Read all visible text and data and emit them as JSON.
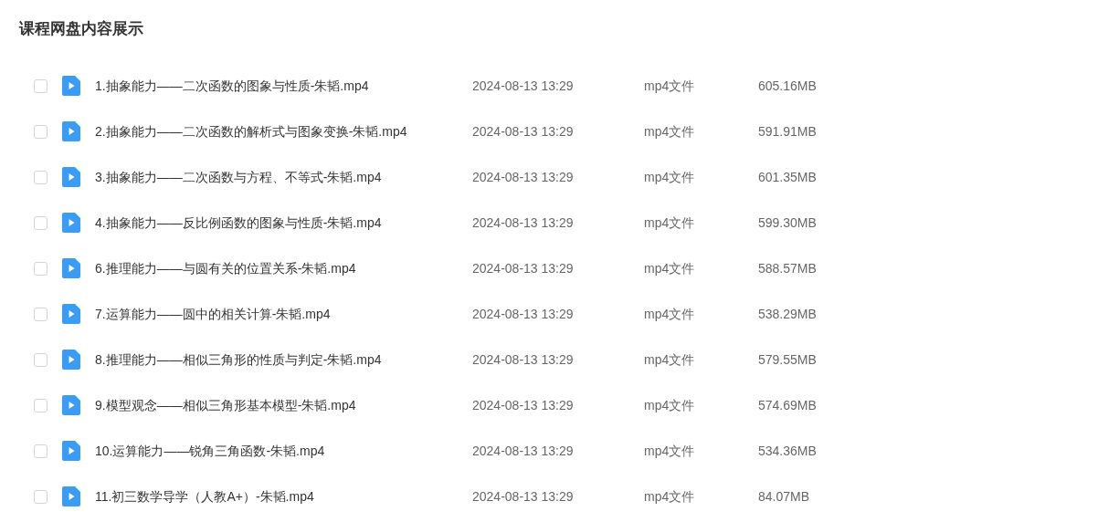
{
  "title": "课程网盘内容展示",
  "files": [
    {
      "name": "1.抽象能力——二次函数的图象与性质-朱韬.mp4",
      "date": "2024-08-13 13:29",
      "type": "mp4文件",
      "size": "605.16MB",
      "checked": false
    },
    {
      "name": "2.抽象能力——二次函数的解析式与图象变换-朱韬.mp4",
      "date": "2024-08-13 13:29",
      "type": "mp4文件",
      "size": "591.91MB",
      "checked": false
    },
    {
      "name": "3.抽象能力——二次函数与方程、不等式-朱韬.mp4",
      "date": "2024-08-13 13:29",
      "type": "mp4文件",
      "size": "601.35MB",
      "checked": false
    },
    {
      "name": "4.抽象能力——反比例函数的图象与性质-朱韬.mp4",
      "date": "2024-08-13 13:29",
      "type": "mp4文件",
      "size": "599.30MB",
      "checked": false
    },
    {
      "name": "6.推理能力——与圆有关的位置关系-朱韬.mp4",
      "date": "2024-08-13 13:29",
      "type": "mp4文件",
      "size": "588.57MB",
      "checked": false
    },
    {
      "name": "7.运算能力——圆中的相关计算-朱韬.mp4",
      "date": "2024-08-13 13:29",
      "type": "mp4文件",
      "size": "538.29MB",
      "checked": false
    },
    {
      "name": "8.推理能力——相似三角形的性质与判定-朱韬.mp4",
      "date": "2024-08-13 13:29",
      "type": "mp4文件",
      "size": "579.55MB",
      "checked": false
    },
    {
      "name": "9.模型观念——相似三角形基本模型-朱韬.mp4",
      "date": "2024-08-13 13:29",
      "type": "mp4文件",
      "size": "574.69MB",
      "checked": false
    },
    {
      "name": "10.运算能力——锐角三角函数-朱韬.mp4",
      "date": "2024-08-13 13:29",
      "type": "mp4文件",
      "size": "534.36MB",
      "checked": false
    },
    {
      "name": "11.初三数学导学（人教A+）-朱韬.mp4",
      "date": "2024-08-13 13:29",
      "type": "mp4文件",
      "size": "84.07MB",
      "checked": false
    }
  ]
}
